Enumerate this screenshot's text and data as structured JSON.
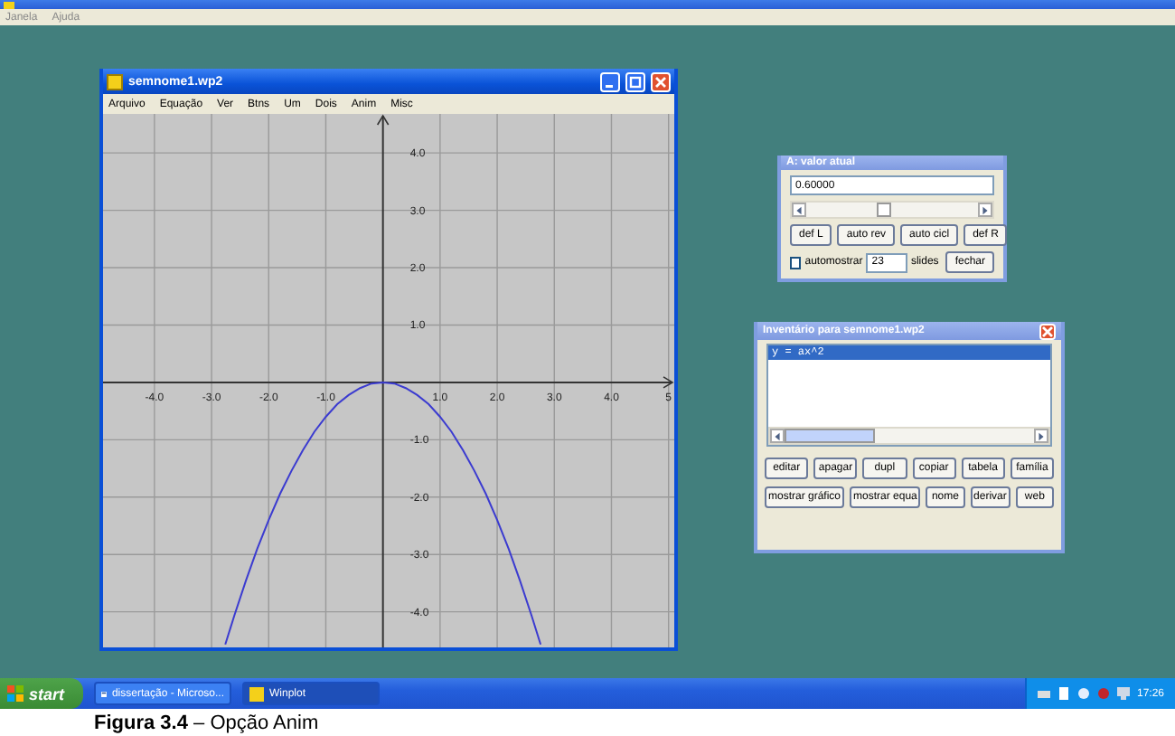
{
  "app_window": {
    "menu": [
      "Janela",
      "Ajuda"
    ]
  },
  "plot_window": {
    "title": "semnome1.wp2",
    "menu": [
      "Arquivo",
      "Equação",
      "Ver",
      "Btns",
      "Um",
      "Dois",
      "Anim",
      "Misc"
    ],
    "chart_data": {
      "type": "line",
      "grid": true,
      "xlim": [
        -4.9,
        5.1
      ],
      "ylim": [
        -4.62,
        4.68
      ],
      "xticks": [
        {
          "value": -4,
          "label": "-4.0"
        },
        {
          "value": -3,
          "label": "-3.0"
        },
        {
          "value": -2,
          "label": "-2.0"
        },
        {
          "value": -1,
          "label": "-1.0"
        },
        {
          "value": 1,
          "label": "1.0"
        },
        {
          "value": 2,
          "label": "2.0"
        },
        {
          "value": 3,
          "label": "3.0"
        },
        {
          "value": 4,
          "label": "4.0"
        },
        {
          "value": 5,
          "label": "5"
        }
      ],
      "yticks": [
        {
          "value": 4,
          "label": "4.0"
        },
        {
          "value": 3,
          "label": "3.0"
        },
        {
          "value": 2,
          "label": "2.0"
        },
        {
          "value": 1,
          "label": "1.0"
        },
        {
          "value": -1,
          "label": "-1.0"
        },
        {
          "value": -2,
          "label": "-2.0"
        },
        {
          "value": -3,
          "label": "-3.0"
        },
        {
          "value": -4,
          "label": "-4.0"
        }
      ],
      "x": [
        -2.76,
        -2.6,
        -2.4,
        -2.2,
        -2.0,
        -1.8,
        -1.6,
        -1.4,
        -1.2,
        -1.0,
        -0.8,
        -0.6,
        -0.4,
        -0.2,
        0,
        0.2,
        0.4,
        0.6,
        0.8,
        1.0,
        1.2,
        1.4,
        1.6,
        1.8,
        2.0,
        2.2,
        2.4,
        2.6,
        2.76
      ],
      "series": [
        {
          "color": "#3b3bd0",
          "values": [
            -4.57,
            -4.06,
            -3.46,
            -2.9,
            -2.4,
            -1.94,
            -1.54,
            -1.18,
            -0.86,
            -0.6,
            -0.38,
            -0.22,
            -0.1,
            -0.02,
            0,
            -0.02,
            -0.1,
            -0.22,
            -0.38,
            -0.6,
            -0.86,
            -1.18,
            -1.54,
            -1.94,
            -2.4,
            -2.9,
            -3.46,
            -4.06,
            -4.57
          ]
        }
      ]
    }
  },
  "anim_dialog": {
    "title": "A: valor atual",
    "value": "0.60000",
    "slider": {
      "level": 0.45
    },
    "buttons": [
      "def L",
      "auto rev",
      "auto cicl",
      "def R"
    ],
    "automostrar": {
      "label": "automostrar",
      "checked": false
    },
    "slides_count": "23",
    "slides_label": "slides",
    "close_button": "fechar"
  },
  "inventory_dialog": {
    "title": "Inventário para semnome1.wp2",
    "items": [
      {
        "text": "y = ax^2",
        "selected": true
      }
    ],
    "buttons": [
      "editar",
      "apagar",
      "dupl",
      "copiar",
      "tabela",
      "família",
      "mostrar gráfico",
      "mostrar equa",
      "nome",
      "derivar",
      "web"
    ]
  },
  "taskbar": {
    "start": "start",
    "tasks": [
      {
        "label": "dissertação - Microso...",
        "selected": false
      },
      {
        "label": "Winplot",
        "selected": true
      }
    ],
    "clock": "17:26"
  },
  "caption": "**Figura 3.4** – Opção Anim"
}
